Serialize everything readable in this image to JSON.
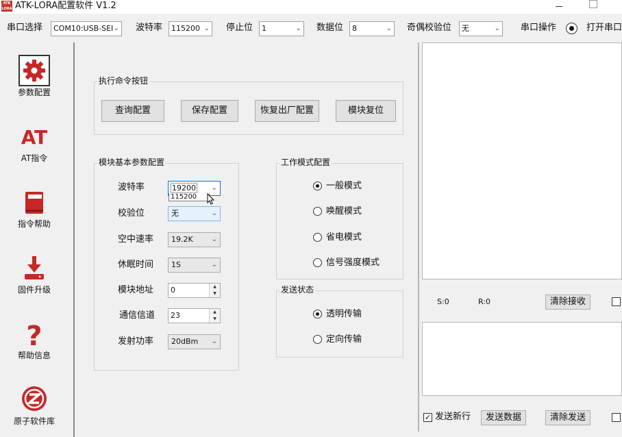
{
  "window": {
    "logo_text": "ATK LORA",
    "title": "ATK-LORA配置软件 V1.2"
  },
  "toolbar": {
    "port_label": "串口选择",
    "port_value": "COM10:USB-SEI",
    "baud_label": "波特率",
    "baud_value": "115200",
    "stopbit_label": "停止位",
    "stopbit_value": "1",
    "databit_label": "数据位",
    "databit_value": "8",
    "parity_label": "奇偶校验位",
    "parity_value": "无",
    "port_op_label": "串口操作",
    "open_port_label": "打开串口"
  },
  "nav": {
    "items": [
      {
        "label": "参数配置",
        "icon": "gear-icon"
      },
      {
        "label": "AT指令",
        "icon": "at-icon"
      },
      {
        "label": "指令帮助",
        "icon": "book-icon"
      },
      {
        "label": "固件升级",
        "icon": "download-icon"
      },
      {
        "label": "帮助信息",
        "icon": "question-icon"
      },
      {
        "label": "原子软件库",
        "icon": "logo-icon"
      }
    ]
  },
  "commands": {
    "group_title": "执行命令按钮",
    "query": "查询配置",
    "save": "保存配置",
    "factory_reset": "恢复出厂配置",
    "module_reset": "模块复位"
  },
  "params": {
    "group_title": "模块基本参数配置",
    "baud_label": "波特率",
    "baud_value": "19200",
    "baud_dropdown_item": "115200",
    "parity_label": "校验位",
    "parity_value": "无",
    "air_rate_label": "空中速率",
    "air_rate_value": "19.2K",
    "sleep_label": "休眠时间",
    "sleep_value": "1S",
    "address_label": "模块地址",
    "address_value": "0",
    "channel_label": "通信信道",
    "channel_value": "23",
    "power_label": "发射功率",
    "power_value": "20dBm"
  },
  "work_mode": {
    "group_title": "工作模式配置",
    "options": [
      "一般模式",
      "唤醒模式",
      "省电模式",
      "信号强度模式"
    ],
    "selected": "一般模式"
  },
  "send_status": {
    "group_title": "发送状态",
    "options": [
      "透明传输",
      "定向传输"
    ],
    "selected": "透明传输"
  },
  "receive": {
    "sent_count": "S:0",
    "recv_count": "R:0",
    "clear_label": "清除接收"
  },
  "send": {
    "newline_label": "发送新行",
    "send_label": "发送数据",
    "clear_label": "清除发送"
  }
}
